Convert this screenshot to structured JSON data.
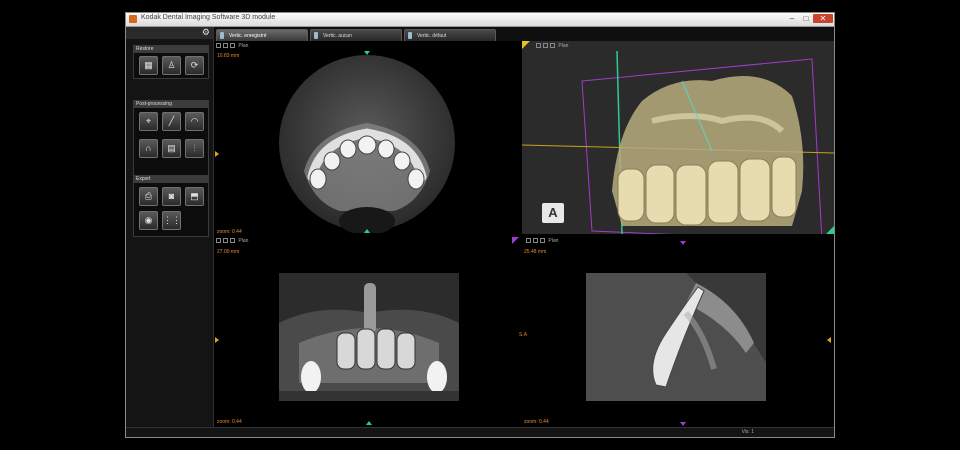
{
  "window": {
    "title": "Kodak Dental Imaging Software 3D module",
    "min_label": "–",
    "max_label": "□",
    "close_label": "✕"
  },
  "left_panel": {
    "groups": [
      {
        "title": "Restore",
        "tools": [
          "scan-icon",
          "tooth-icon",
          "rotate-icon"
        ]
      },
      {
        "title": "Post-processing",
        "tools": [
          "measure-icon",
          "ruler-icon",
          "curve-icon",
          "arch-icon",
          "volume-icon",
          "implant-icon"
        ]
      },
      {
        "title": "Export",
        "tools": [
          "print-icon",
          "camera-icon",
          "save-icon",
          "disc-icon",
          "grid-icon"
        ]
      }
    ]
  },
  "tabs": [
    {
      "label": "Vertic. enregistré"
    },
    {
      "label": "Vertic. aucun"
    },
    {
      "label": "Vertic. défaut"
    }
  ],
  "views": {
    "axial": {
      "thickness": "10.83 mm",
      "zoom": "zoom: 0.44",
      "toolbar_text": "Plan"
    },
    "volume": {
      "badge": "A",
      "toolbar_text": "Plan"
    },
    "coronal": {
      "thickness": "27.00 mm",
      "zoom": "zoom: 0.44",
      "toolbar_text": "Plan"
    },
    "sagittal": {
      "thickness": "25.48 mm",
      "zoom": "zoom: 0.44",
      "toolbar_text": "Plan",
      "side_label": "S.A"
    }
  },
  "status": {
    "text": "Vis: 1"
  },
  "colors": {
    "accent_orange": "#e88a2a",
    "marker_green": "#2ecc8e",
    "marker_purple": "#a03cc8",
    "bone": "#d9cfa0"
  }
}
